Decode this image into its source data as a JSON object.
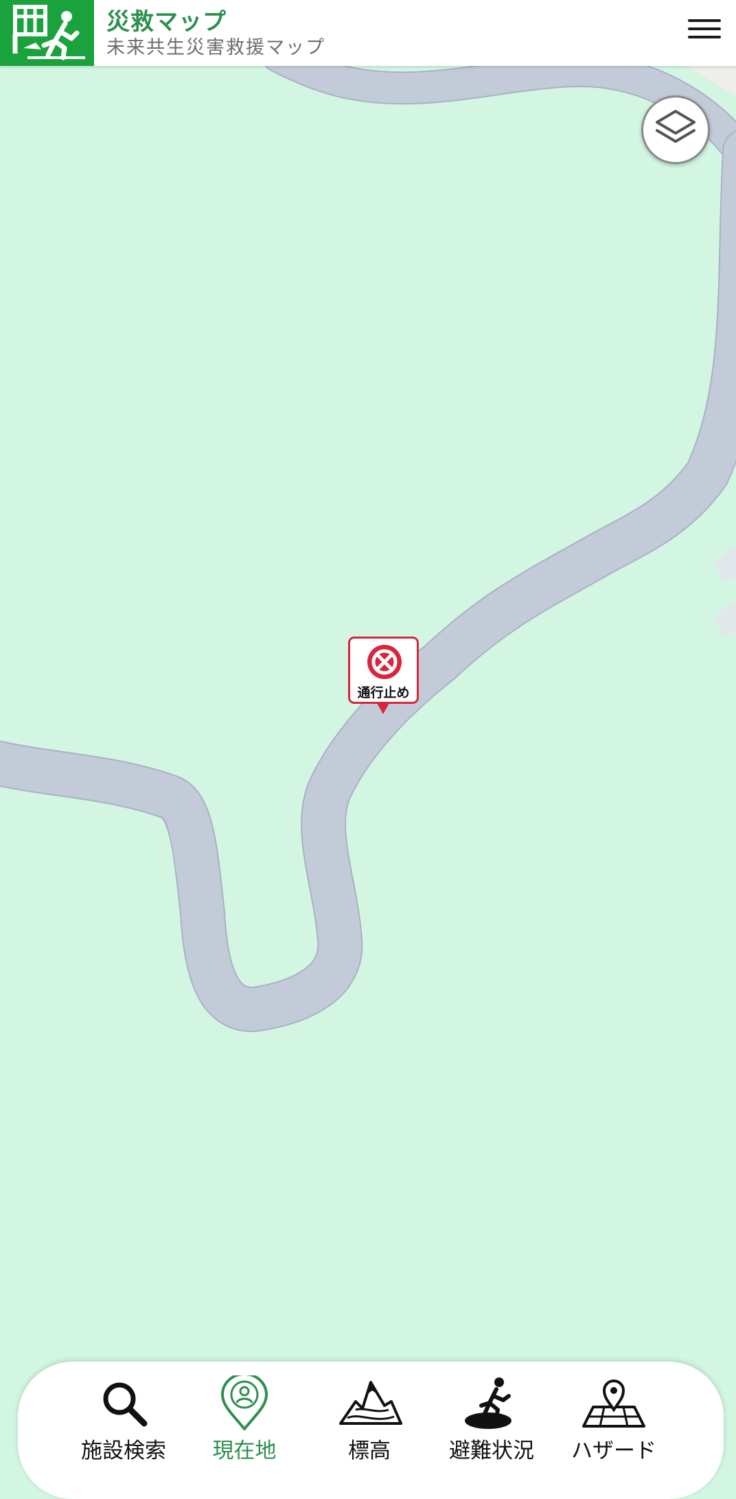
{
  "header": {
    "title": "災救マップ",
    "subtitle": "未来共生災害救援マップ"
  },
  "map": {
    "background_color": "#d2f6e1",
    "road_color": "#c3cad8",
    "road_border_color": "#a9b2c5"
  },
  "marker": {
    "label": "通行止め",
    "icon": "road-closed-icon",
    "color": "#d7263d"
  },
  "bottom_nav": {
    "active_color": "#2d8f4e",
    "items": [
      {
        "label": "施設検索",
        "icon": "search-icon"
      },
      {
        "label": "現在地",
        "icon": "location-pin-icon",
        "active": true
      },
      {
        "label": "標高",
        "icon": "mountain-icon"
      },
      {
        "label": "避難状況",
        "icon": "evacuation-runner-icon"
      },
      {
        "label": "ハザード",
        "icon": "hazard-map-icon"
      }
    ]
  }
}
